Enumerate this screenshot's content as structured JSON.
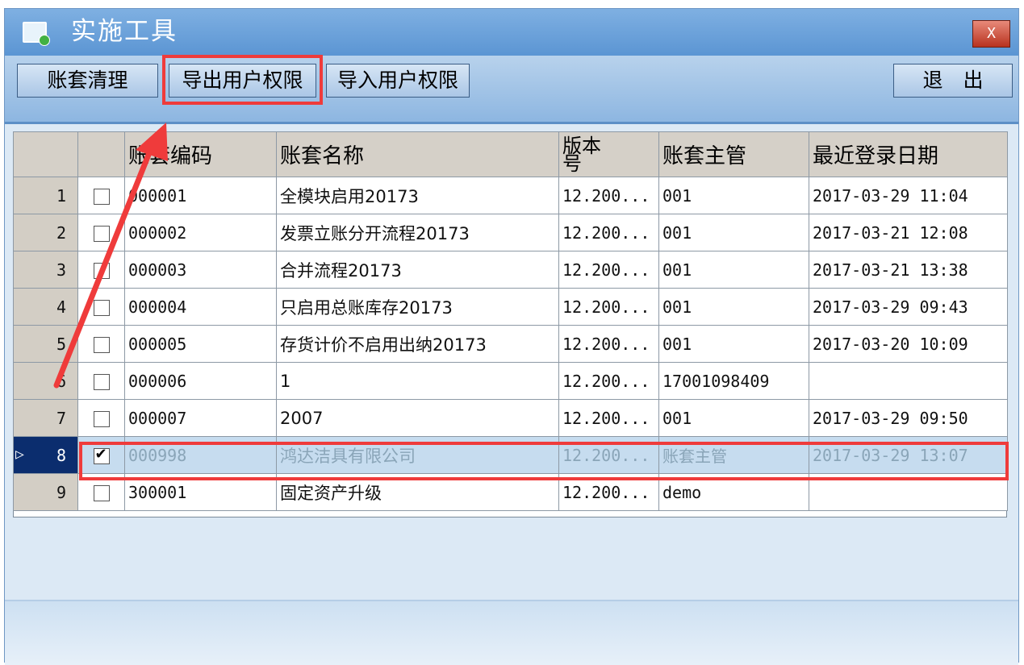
{
  "window": {
    "title": "实施工具",
    "close_label": "X"
  },
  "toolbar": {
    "buttons": [
      "账套清理",
      "导出用户权限",
      "导入用户权限"
    ],
    "exit_label": "退　出"
  },
  "table": {
    "columns": [
      "",
      "",
      "账套编码",
      "账套名称",
      "版本\n号",
      "账套主管",
      "最近登录日期"
    ],
    "rows": [
      {
        "num": "1",
        "checked": false,
        "code": "000001",
        "name": "全模块启用20173",
        "version": "12.200...",
        "manager": "001",
        "date": "2017-03-29 11:04"
      },
      {
        "num": "2",
        "checked": false,
        "code": "000002",
        "name": "发票立账分开流程20173",
        "version": "12.200...",
        "manager": "001",
        "date": "2017-03-21 12:08"
      },
      {
        "num": "3",
        "checked": false,
        "code": "000003",
        "name": "合并流程20173",
        "version": "12.200...",
        "manager": "001",
        "date": "2017-03-21 13:38"
      },
      {
        "num": "4",
        "checked": false,
        "code": "000004",
        "name": "只启用总账库存20173",
        "version": "12.200...",
        "manager": "001",
        "date": "2017-03-29 09:43"
      },
      {
        "num": "5",
        "checked": false,
        "code": "000005",
        "name": "存货计价不启用出纳20173",
        "version": "12.200...",
        "manager": "001",
        "date": "2017-03-20 10:09"
      },
      {
        "num": "6",
        "checked": false,
        "code": "000006",
        "name": "1",
        "version": "12.200...",
        "manager": "17001098409",
        "date": ""
      },
      {
        "num": "7",
        "checked": false,
        "code": "000007",
        "name": "2007",
        "version": "12.200...",
        "manager": "001",
        "date": "2017-03-29 09:50"
      },
      {
        "num": "8",
        "checked": true,
        "code": "000998",
        "name": "鸿达洁具有限公司",
        "version": "12.200...",
        "manager": "账套主管",
        "date": "2017-03-29 13:07"
      },
      {
        "num": "9",
        "checked": false,
        "code": "300001",
        "name": "固定资产升级",
        "version": "12.200...",
        "manager": "demo",
        "date": ""
      }
    ],
    "selected_row": 7
  },
  "colors": {
    "highlight": "#ef3b3b",
    "selected_row": "#c6dcef",
    "title_bar": "#6fa6dd"
  }
}
